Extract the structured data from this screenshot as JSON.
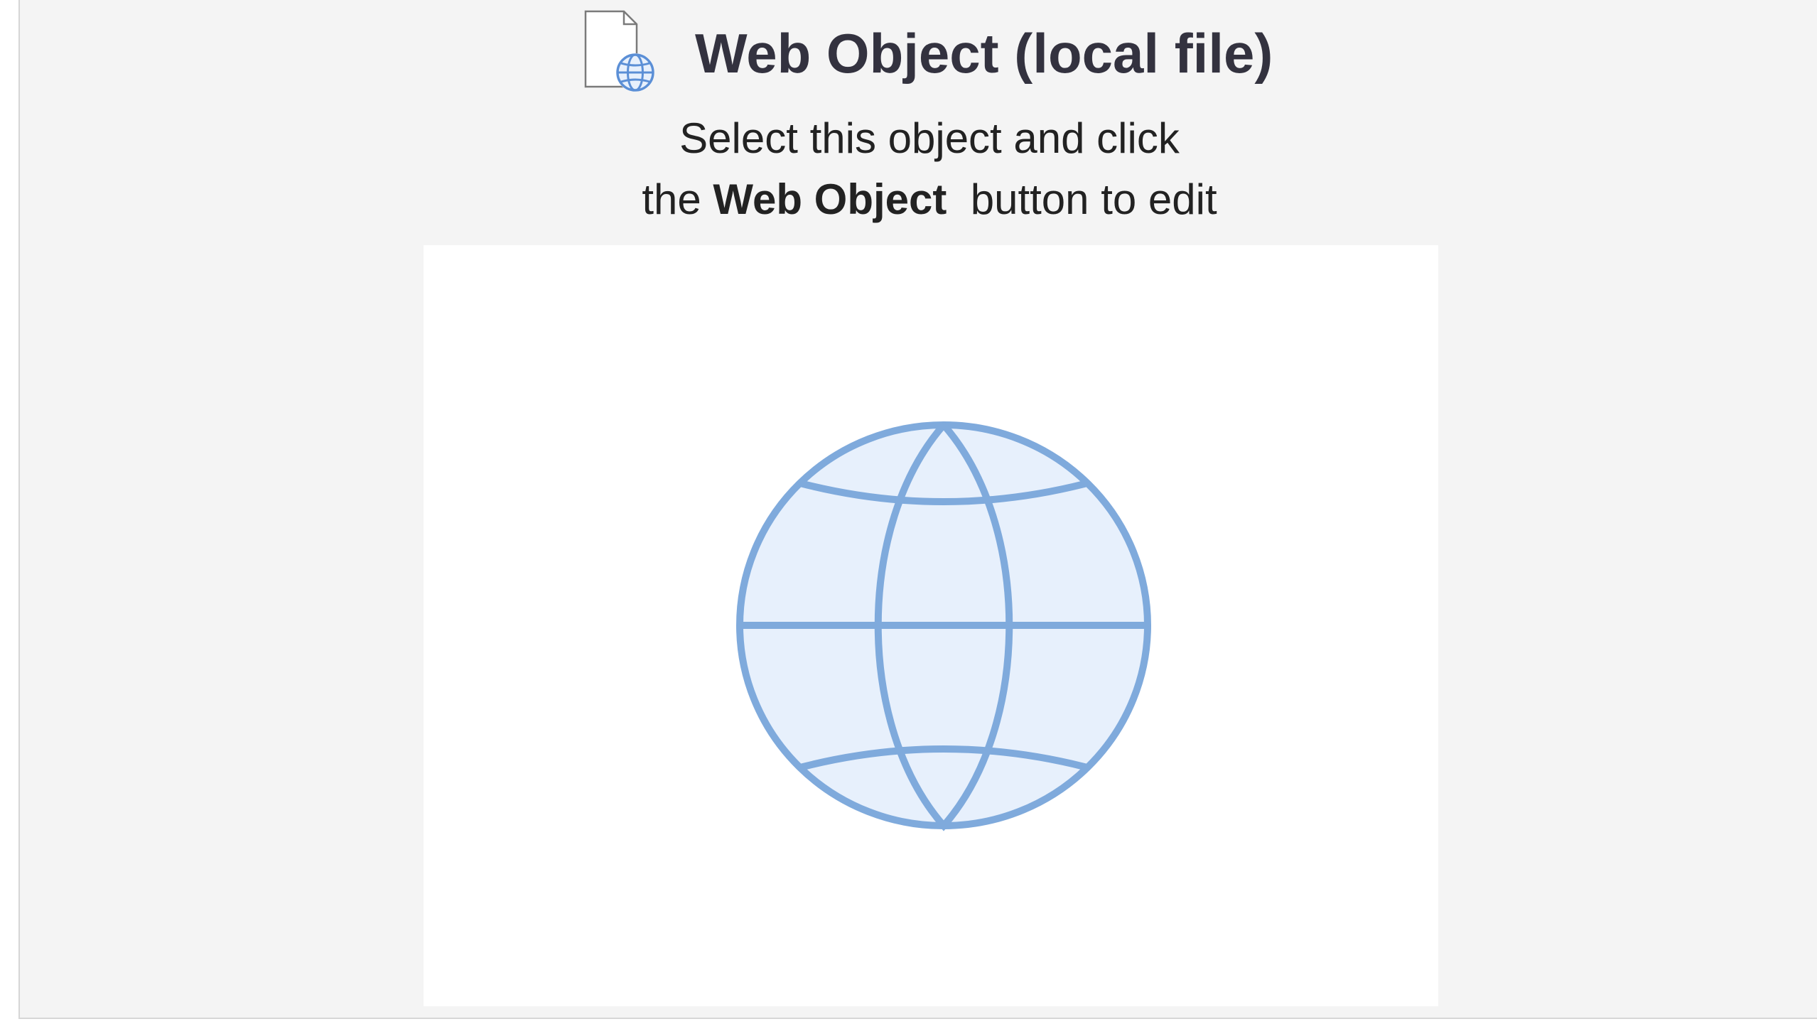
{
  "header": {
    "title": "Web Object (local file)",
    "icon": "web-file-icon"
  },
  "instructions": {
    "line1": "Select this object and click",
    "line2_prefix": "the",
    "line2_bold": "Web Object",
    "line2_suffix": "button to edit"
  },
  "preview": {
    "icon": "globe-icon"
  },
  "colors": {
    "panel_background": "#f4f4f4",
    "preview_background": "#ffffff",
    "title_text": "#33323f",
    "globe_stroke": "#7faadc",
    "globe_fill": "#e7f0fc",
    "file_outline": "#7a7a7a"
  }
}
